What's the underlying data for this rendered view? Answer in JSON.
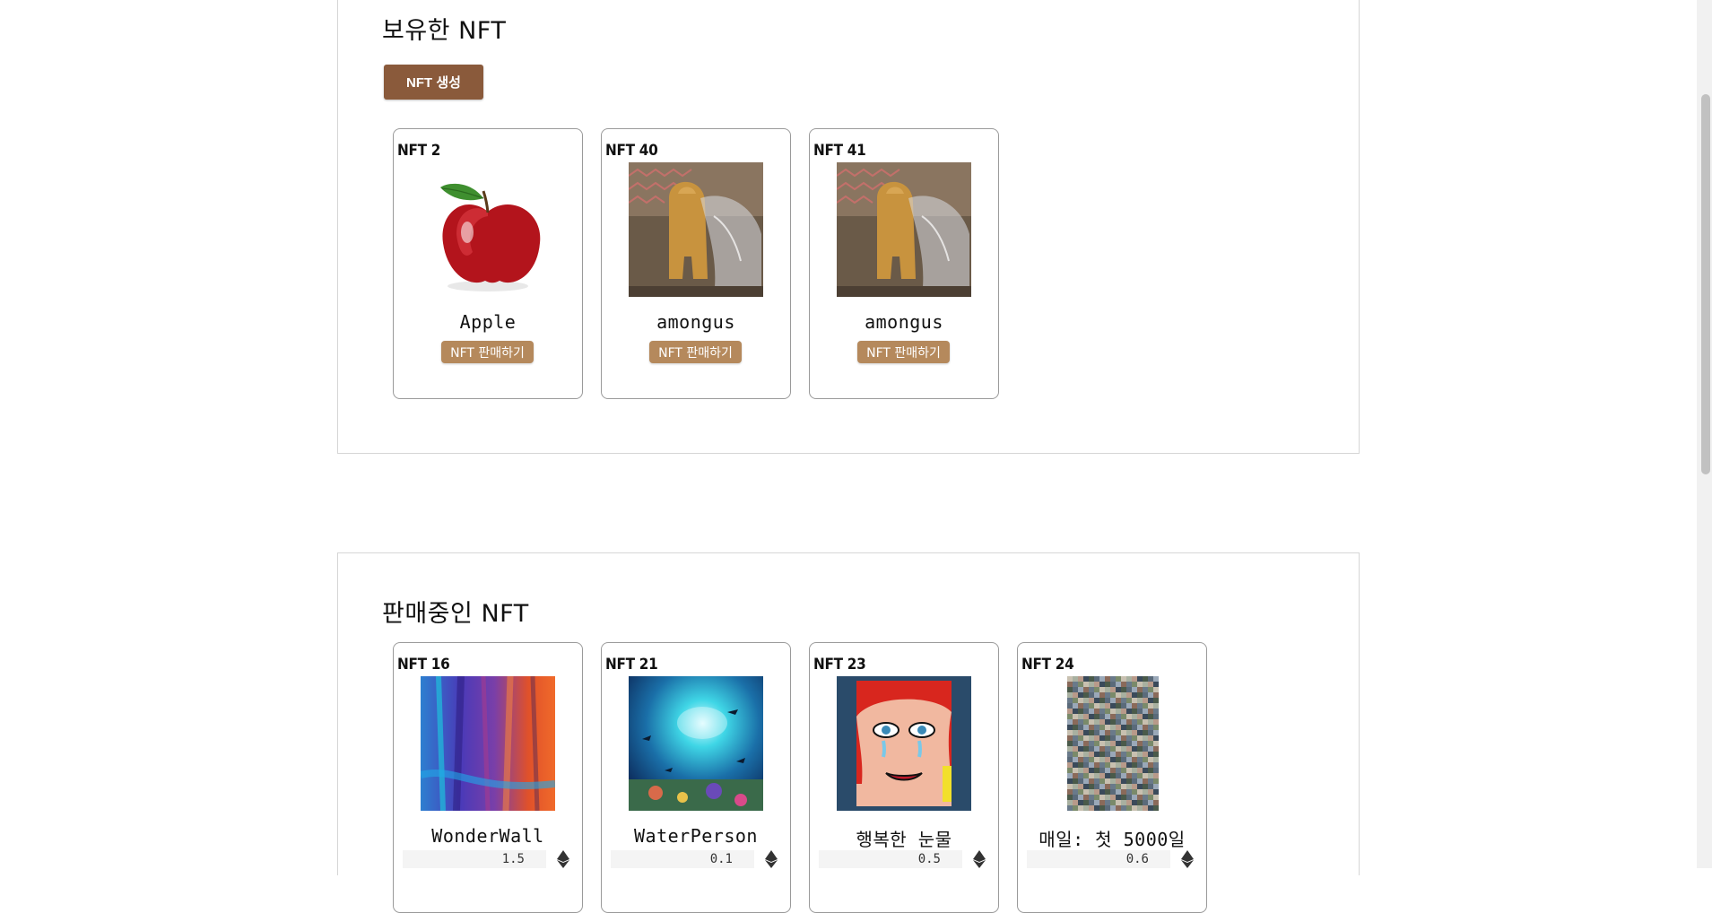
{
  "owned": {
    "title": "보유한 NFT",
    "create_button": "NFT 생성",
    "cards": [
      {
        "id_label": "NFT 2",
        "name": "Apple",
        "sell_label": "NFT 판매하기",
        "image": "apple"
      },
      {
        "id_label": "NFT 40",
        "name": "amongus",
        "sell_label": "NFT 판매하기",
        "image": "amongus"
      },
      {
        "id_label": "NFT 41",
        "name": "amongus",
        "sell_label": "NFT 판매하기",
        "image": "amongus"
      }
    ]
  },
  "on_sale": {
    "title": "판매중인 NFT",
    "cards": [
      {
        "id_label": "NFT 16",
        "name": "WonderWall",
        "price": "1.5",
        "image": "wonderwall"
      },
      {
        "id_label": "NFT 21",
        "name": "WaterPerson",
        "price": "0.1",
        "image": "waterperson"
      },
      {
        "id_label": "NFT 23",
        "name": "행복한 눈물",
        "price": "0.5",
        "image": "happy-tears"
      },
      {
        "id_label": "NFT 24",
        "name": "매일: 첫 5000일",
        "price": "0.6",
        "image": "everydays"
      }
    ]
  },
  "icons": {
    "currency": "ethereum-icon"
  },
  "colors": {
    "create_button": "#8a5a3b",
    "sell_button": "#b5895c"
  }
}
